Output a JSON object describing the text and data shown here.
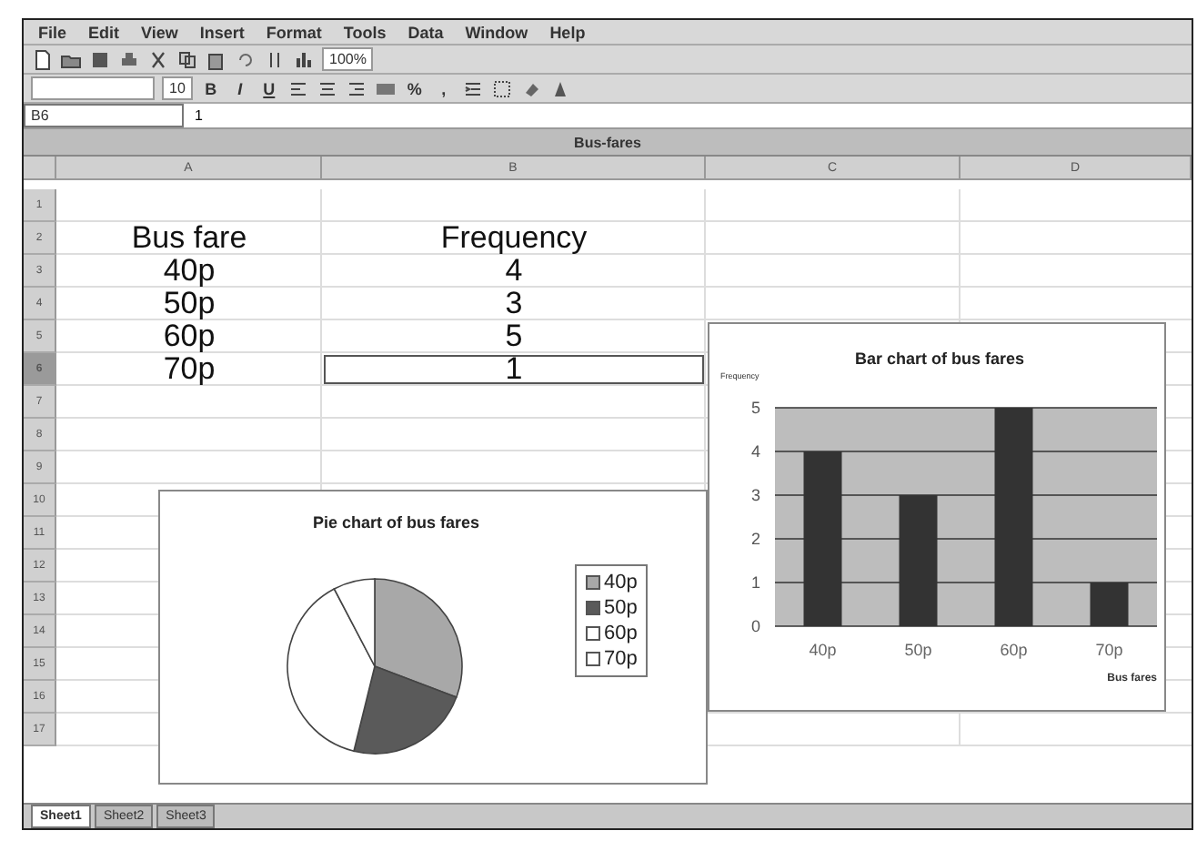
{
  "menu": [
    "File",
    "Edit",
    "View",
    "Insert",
    "Format",
    "Tools",
    "Data",
    "Window",
    "Help"
  ],
  "toolbar": {
    "zoom": "100%",
    "font_size": "10",
    "format_buttons": [
      "B",
      "I",
      "U"
    ],
    "percent": "%",
    "comma": ","
  },
  "formula_bar": {
    "name_box": "B6",
    "value": "1"
  },
  "workbook": {
    "title": "Bus-fares"
  },
  "columns": [
    "A",
    "B",
    "C",
    "D"
  ],
  "rows": [
    {
      "number": "1",
      "cells": [],
      "selected": false
    },
    {
      "number": "2",
      "cells": [
        "Bus fare",
        "Frequency"
      ],
      "selected": false
    },
    {
      "number": "3",
      "cells": [
        "40p",
        "4"
      ],
      "selected": false
    },
    {
      "number": "4",
      "cells": [
        "50p",
        "3"
      ],
      "selected": false
    },
    {
      "number": "5",
      "cells": [
        "60p",
        "5"
      ],
      "selected": false
    },
    {
      "number": "6",
      "cells": [
        "70p",
        "1"
      ],
      "selected": true
    },
    {
      "number": "7",
      "cells": [],
      "selected": false
    },
    {
      "number": "8",
      "cells": [],
      "selected": false
    },
    {
      "number": "9",
      "cells": [],
      "selected": false
    },
    {
      "number": "10",
      "cells": [],
      "selected": false
    },
    {
      "number": "11",
      "cells": [],
      "selected": false
    },
    {
      "number": "12",
      "cells": [],
      "selected": false
    },
    {
      "number": "13",
      "cells": [],
      "selected": false
    },
    {
      "number": "14",
      "cells": [],
      "selected": false
    },
    {
      "number": "15",
      "cells": [],
      "selected": false
    },
    {
      "number": "16",
      "cells": [],
      "selected": false
    },
    {
      "number": "17",
      "cells": [],
      "selected": false
    }
  ],
  "pie_chart": {
    "chart_data": {
      "type": "pie",
      "title": "Pie chart of bus fares",
      "categories": [
        "40p",
        "50p",
        "60p",
        "70p"
      ],
      "series": [
        {
          "values": [
            30.77,
            23.08,
            38.46,
            7.69
          ],
          "colors": [
            "#a8a8a8",
            "#5a5a5a",
            "#ffffff",
            "#ffffff"
          ]
        }
      ]
    }
  },
  "bar_chart": {
    "chart_data": {
      "type": "bar",
      "title": "Bar chart of bus fares",
      "xlabel": "Bus fares",
      "ylabel": "Frequency",
      "categories": [
        "40p",
        "50p",
        "60p",
        "70p"
      ],
      "series": [
        {
          "color": "#333333",
          "values": [
            4,
            3,
            5,
            1
          ]
        }
      ],
      "ylim": [
        0,
        5
      ],
      "yticks": [
        0,
        1,
        2,
        3,
        4,
        5
      ],
      "grid": true
    }
  },
  "sheet_tabs": [
    {
      "label": "Sheet1",
      "selected": true
    },
    {
      "label": "Sheet2",
      "selected": false
    },
    {
      "label": "Sheet3",
      "selected": false
    }
  ]
}
